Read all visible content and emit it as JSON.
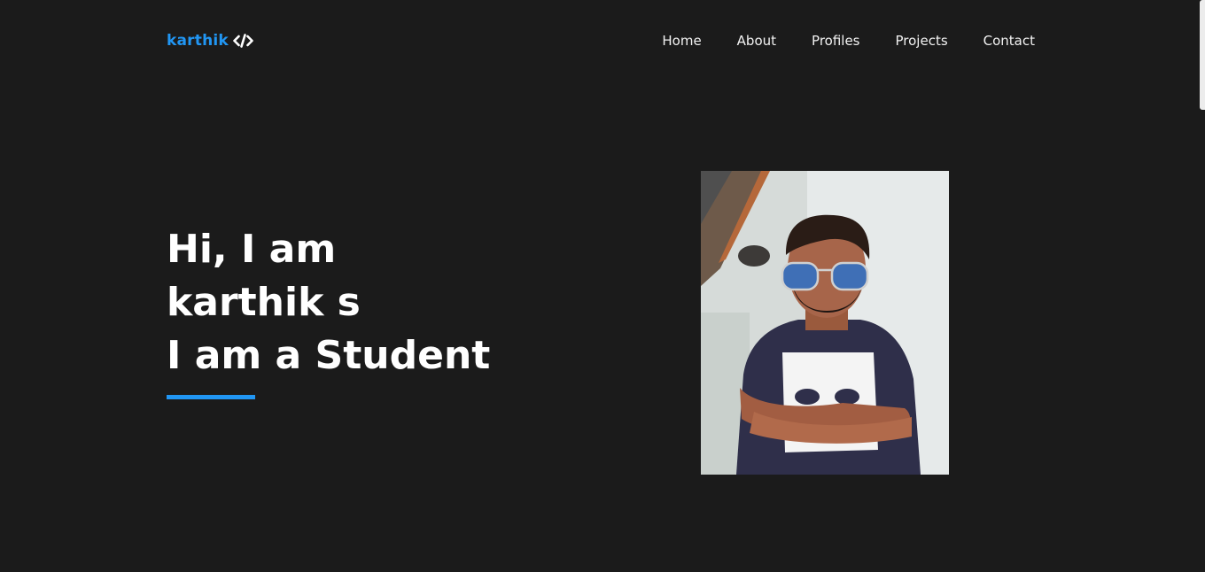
{
  "header": {
    "logo_text": "karthik",
    "logo_icon": "code-icon"
  },
  "nav": {
    "items": [
      {
        "label": "Home"
      },
      {
        "label": "About"
      },
      {
        "label": "Profiles"
      },
      {
        "label": "Projects"
      },
      {
        "label": "Contact"
      }
    ]
  },
  "hero": {
    "line1": "Hi, I am",
    "line2": "karthik s",
    "line3": "I am a Student"
  },
  "colors": {
    "background": "#1b1b1b",
    "accent": "#2196f3",
    "text": "#ffffff"
  }
}
